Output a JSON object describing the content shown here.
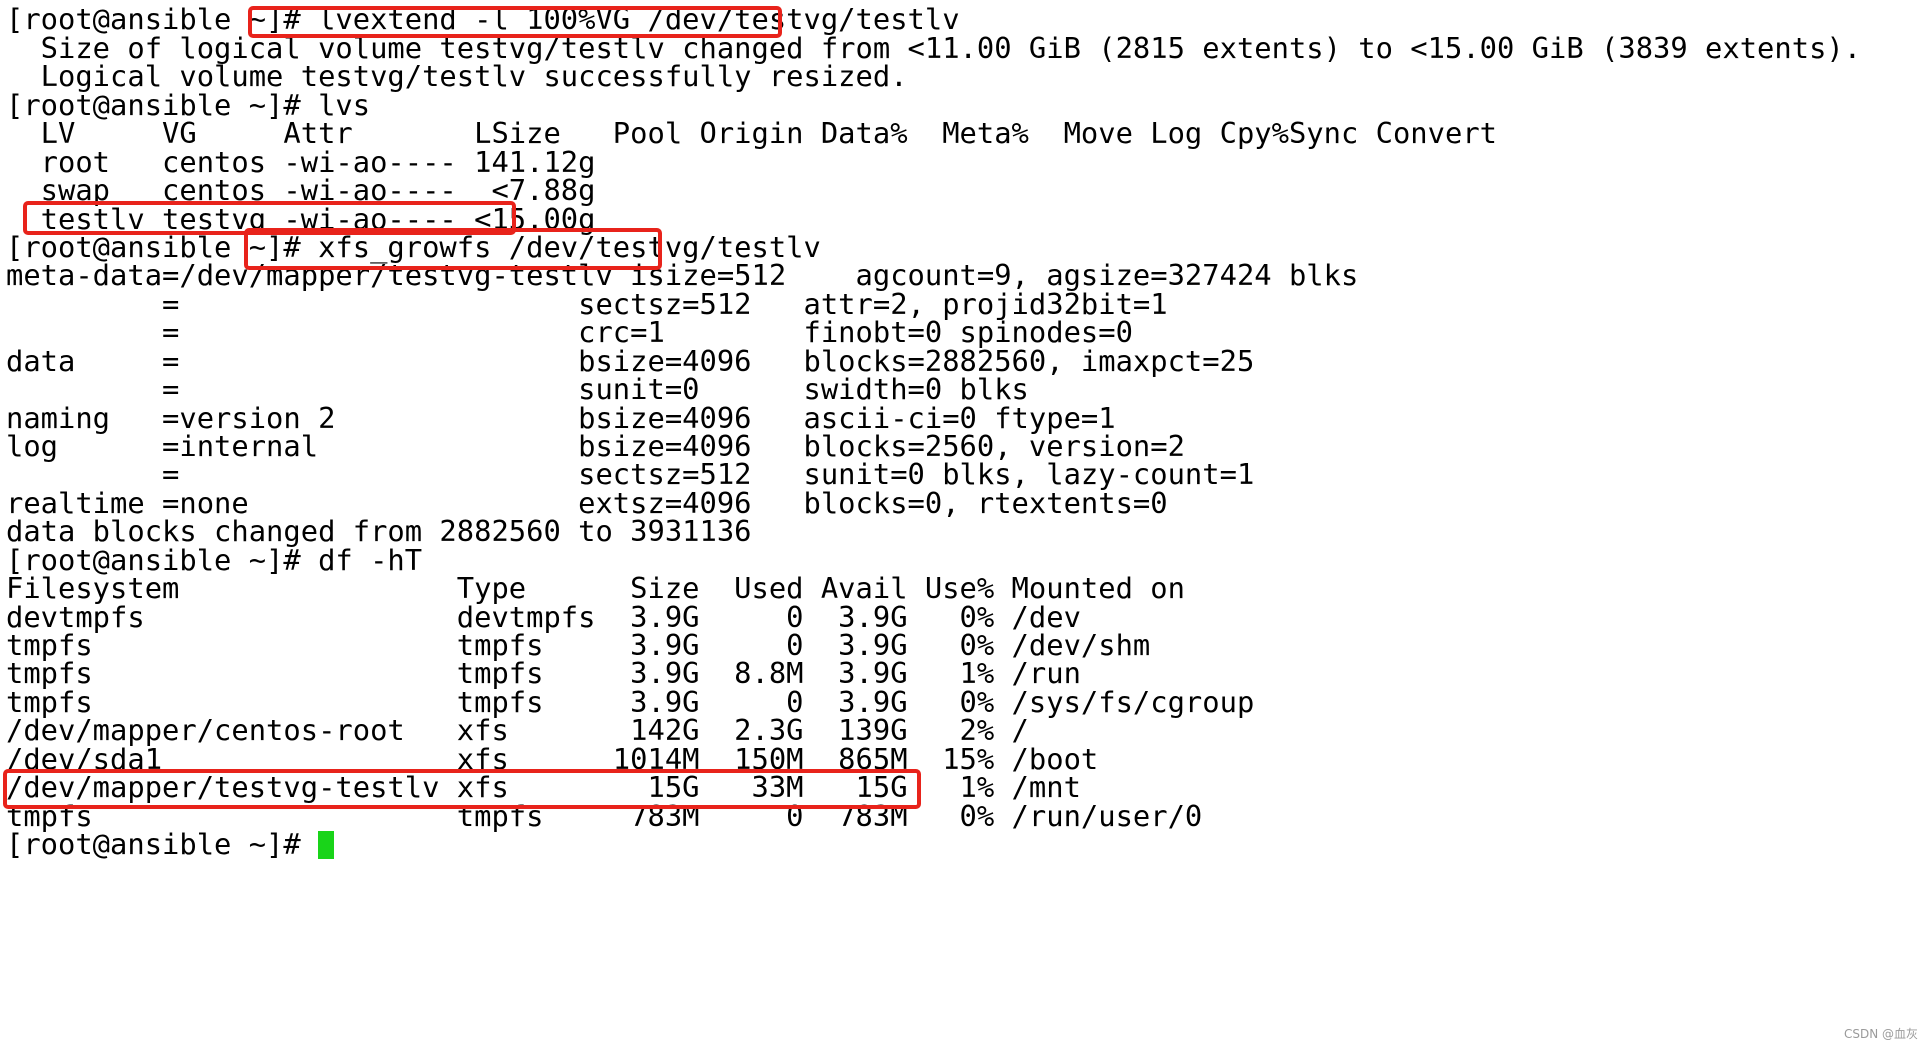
{
  "terminal": {
    "lines": [
      "[root@ansible ~]# lvextend -l 100%VG /dev/testvg/testlv",
      "  Size of logical volume testvg/testlv changed from <11.00 GiB (2815 extents) to <15.00 GiB (3839 extents).",
      "  Logical volume testvg/testlv successfully resized.",
      "[root@ansible ~]# lvs",
      "  LV     VG     Attr       LSize   Pool Origin Data%  Meta%  Move Log Cpy%Sync Convert",
      "  root   centos -wi-ao---- 141.12g",
      "  swap   centos -wi-ao----  <7.88g",
      "  testlv testvg -wi-ao---- <15.00g",
      "[root@ansible ~]# xfs_growfs /dev/testvg/testlv",
      "meta-data=/dev/mapper/testvg-testlv isize=512    agcount=9, agsize=327424 blks",
      "         =                       sectsz=512   attr=2, projid32bit=1",
      "         =                       crc=1        finobt=0 spinodes=0",
      "data     =                       bsize=4096   blocks=2882560, imaxpct=25",
      "         =                       sunit=0      swidth=0 blks",
      "naming   =version 2              bsize=4096   ascii-ci=0 ftype=1",
      "log      =internal               bsize=4096   blocks=2560, version=2",
      "         =                       sectsz=512   sunit=0 blks, lazy-count=1",
      "realtime =none                   extsz=4096   blocks=0, rtextents=0",
      "data blocks changed from 2882560 to 3931136",
      "[root@ansible ~]# df -hT",
      "Filesystem                Type      Size  Used Avail Use% Mounted on",
      "devtmpfs                  devtmpfs  3.9G     0  3.9G   0% /dev",
      "tmpfs                     tmpfs     3.9G     0  3.9G   0% /dev/shm",
      "tmpfs                     tmpfs     3.9G  8.8M  3.9G   1% /run",
      "tmpfs                     tmpfs     3.9G     0  3.9G   0% /sys/fs/cgroup",
      "/dev/mapper/centos-root   xfs       142G  2.3G  139G   2% /",
      "/dev/sda1                 xfs      1014M  150M  865M  15% /boot",
      "/dev/mapper/testvg-testlv xfs        15G   33M   15G   1% /mnt",
      "tmpfs                     tmpfs     783M     0  783M   0% /run/user/0",
      "[root@ansible ~]# "
    ]
  },
  "highlight_color": "#e8231b",
  "cursor_color": "#19d419",
  "watermark": "CSDN @血灰"
}
